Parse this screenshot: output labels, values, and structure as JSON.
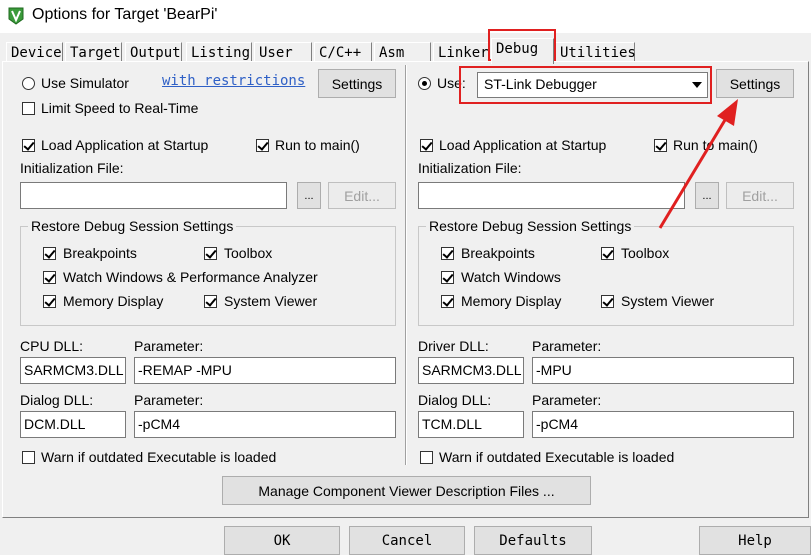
{
  "window": {
    "title": "Options for Target 'BearPi'"
  },
  "tabs": [
    {
      "label": "Device"
    },
    {
      "label": "Target"
    },
    {
      "label": "Output"
    },
    {
      "label": "Listing"
    },
    {
      "label": "User"
    },
    {
      "label": "C/C++"
    },
    {
      "label": "Asm"
    },
    {
      "label": "Linker"
    },
    {
      "label": "Debug",
      "active": true
    },
    {
      "label": "Utilities"
    }
  ],
  "left": {
    "use_simulator": "Use Simulator",
    "restrictions_link": "with restrictions",
    "settings": "Settings",
    "limit_speed": "Limit Speed to Real-Time",
    "load_app": "Load Application at Startup",
    "run_to_main": "Run to main()",
    "init_file_label": "Initialization File:",
    "init_file_value": "",
    "browse": "...",
    "edit": "Edit...",
    "restore_group": "Restore Debug Session Settings",
    "breakpoints": "Breakpoints",
    "toolbox": "Toolbox",
    "watch_windows": "Watch Windows & Performance Analyzer",
    "memory_display": "Memory Display",
    "system_viewer": "System Viewer",
    "dll_label": "CPU DLL:",
    "parameter_label": "Parameter:",
    "dll_value": "SARMCM3.DLL",
    "dll_param": "-REMAP -MPU",
    "dialog_dll_label": "Dialog DLL:",
    "dialog_dll_value": "DCM.DLL",
    "dialog_param": "-pCM4",
    "warn_outdated": "Warn if outdated Executable is loaded"
  },
  "right": {
    "use_label": "Use:",
    "debugger": "ST-Link Debugger",
    "settings": "Settings",
    "load_app": "Load Application at Startup",
    "run_to_main": "Run to main()",
    "init_file_label": "Initialization File:",
    "init_file_value": "",
    "browse": "...",
    "edit": "Edit...",
    "restore_group": "Restore Debug Session Settings",
    "breakpoints": "Breakpoints",
    "toolbox": "Toolbox",
    "watch_windows": "Watch Windows",
    "memory_display": "Memory Display",
    "system_viewer": "System Viewer",
    "dll_label": "Driver DLL:",
    "parameter_label": "Parameter:",
    "dll_value": "SARMCM3.DLL",
    "dll_param": "-MPU",
    "dialog_dll_label": "Dialog DLL:",
    "dialog_dll_value": "TCM.DLL",
    "dialog_param": "-pCM4",
    "warn_outdated": "Warn if outdated Executable is loaded"
  },
  "manage_button": "Manage Component Viewer Description Files ...",
  "footer": {
    "ok": "OK",
    "cancel": "Cancel",
    "defaults": "Defaults",
    "help": "Help"
  },
  "annotation_color": "#e02020"
}
